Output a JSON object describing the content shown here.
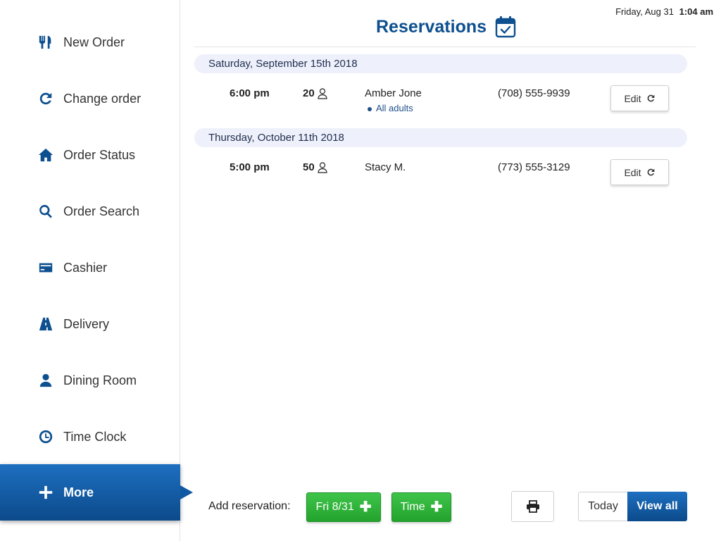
{
  "header": {
    "date": "Friday, Aug 31",
    "time": "1:04 am",
    "title": "Reservations",
    "title_icon": "calendar-check-icon"
  },
  "sidebar": {
    "items": [
      {
        "label": "New Order",
        "icon": "fork-knife-icon",
        "active": false
      },
      {
        "label": "Change order",
        "icon": "refresh-icon",
        "active": false
      },
      {
        "label": "Order Status",
        "icon": "home-icon",
        "active": false
      },
      {
        "label": "Order Search",
        "icon": "search-icon",
        "active": false
      },
      {
        "label": "Cashier",
        "icon": "credit-card-icon",
        "active": false
      },
      {
        "label": "Delivery",
        "icon": "road-icon",
        "active": false
      },
      {
        "label": "Dining Room",
        "icon": "user-icon",
        "active": false
      },
      {
        "label": "Time Clock",
        "icon": "clock-icon",
        "active": false
      },
      {
        "label": "More",
        "icon": "plus-icon",
        "active": true
      }
    ]
  },
  "reservations": {
    "groups": [
      {
        "date": "Saturday, September 15th 2018",
        "items": [
          {
            "time": "6:00 pm",
            "party": "20",
            "name": "Amber Jone",
            "note": "All adults",
            "phone": "(708) 555-9939",
            "edit_label": "Edit"
          }
        ]
      },
      {
        "date": "Thursday, October 11th 2018",
        "items": [
          {
            "time": "5:00 pm",
            "party": "50",
            "name": "Stacy M.",
            "note": "",
            "phone": "(773) 555-3129",
            "edit_label": "Edit"
          }
        ]
      }
    ]
  },
  "footer": {
    "add_label": "Add reservation:",
    "date_button": "Fri 8/31",
    "time_button": "Time",
    "print_icon": "printer-icon",
    "today_button": "Today",
    "view_all_button": "View all"
  },
  "colors": {
    "brand_blue": "#0d4f8f",
    "green": "#23a32d",
    "date_bar": "#eef1fb"
  }
}
